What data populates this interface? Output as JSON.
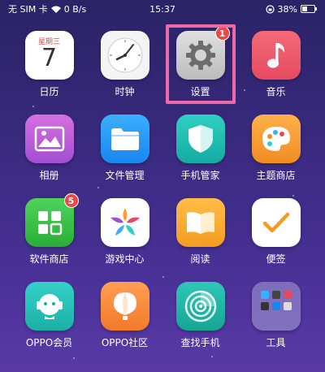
{
  "status_bar": {
    "carrier": "无 SIM 卡",
    "speed": "0 B/s",
    "time": "15:37",
    "battery": "38%"
  },
  "apps": [
    {
      "label": "日历",
      "icon": "calendar-icon",
      "weekday": "星期三",
      "day": "7"
    },
    {
      "label": "时钟",
      "icon": "clock-icon"
    },
    {
      "label": "设置",
      "icon": "gear-icon",
      "badge": "1"
    },
    {
      "label": "音乐",
      "icon": "music-note-icon"
    },
    {
      "label": "相册",
      "icon": "photo-icon"
    },
    {
      "label": "文件管理",
      "icon": "folder-icon"
    },
    {
      "label": "手机管家",
      "icon": "shield-icon"
    },
    {
      "label": "主题商店",
      "icon": "palette-icon"
    },
    {
      "label": "软件商店",
      "icon": "app-store-icon",
      "badge": "5"
    },
    {
      "label": "游戏中心",
      "icon": "game-star-icon"
    },
    {
      "label": "阅读",
      "icon": "book-icon"
    },
    {
      "label": "便签",
      "icon": "checkmark-note-icon"
    },
    {
      "label": "OPPO会员",
      "icon": "member-icon"
    },
    {
      "label": "OPPO社区",
      "icon": "balloon-icon"
    },
    {
      "label": "查找手机",
      "icon": "radar-icon"
    },
    {
      "label": "工具",
      "icon": "folder-grid-icon"
    }
  ],
  "colors": {
    "highlight": "#ee6aa7",
    "badge": "#e84a4a"
  }
}
